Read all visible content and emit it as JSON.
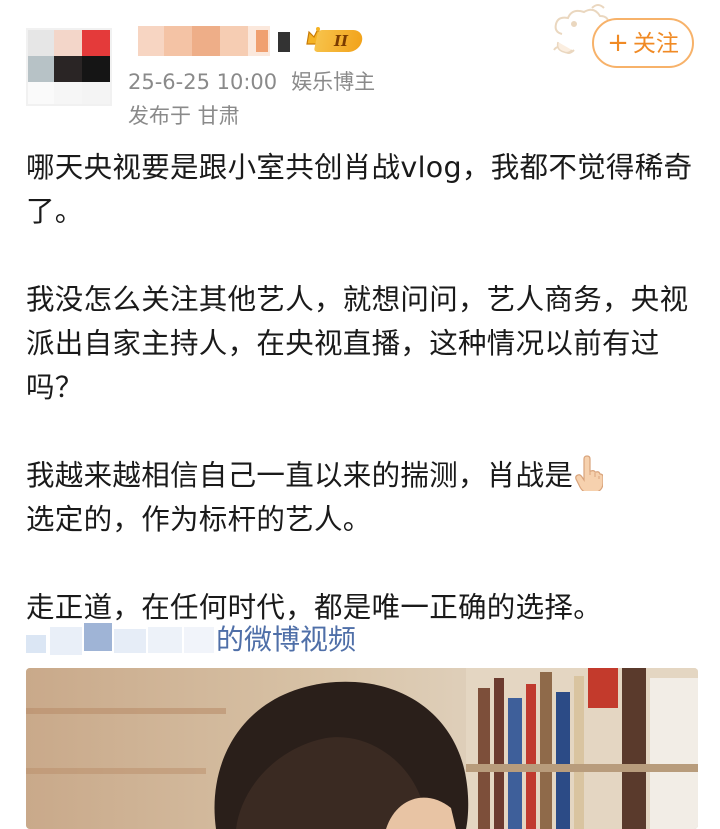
{
  "user": {
    "name_hidden": true,
    "level_badge": "II"
  },
  "post_meta": {
    "date": "25-6-25 10:00",
    "role": "娱乐博主",
    "location": "发布于 甘肃"
  },
  "follow_button": {
    "plus": "+",
    "label": "关注"
  },
  "post_body": {
    "p1": "哪天央视要是跟小室共创肖战vlog，我都不觉得稀奇了。",
    "p2": "我没怎么关注其他艺人，就想问问，艺人商务，央视派出自家主持人，在央视直播，这种情况以前有过吗？",
    "p3_a": "我越来越相信自己一直以来的揣测，肖战是",
    "p3_b": "选定的，作为标杆的艺人。",
    "p4": "走正道，在任何时代，都是唯一正确的选择。"
  },
  "video_link": {
    "visible_suffix": "的微博视频"
  },
  "icons": {
    "pointing_hand": "pointing-up-hand-emoji",
    "crown": "crown-icon"
  },
  "colors": {
    "meta_gray": "#8a8a8a",
    "link_blue": "#4f6fa8",
    "follow_orange": "#f08a24",
    "badge_gold": "#f7c24a"
  }
}
